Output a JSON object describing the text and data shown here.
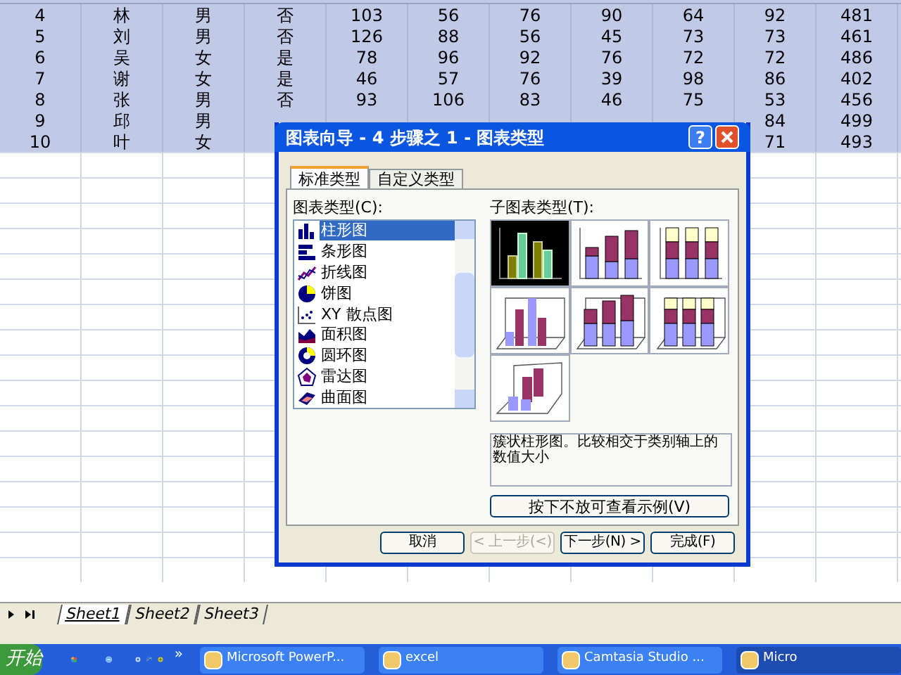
{
  "sheet": {
    "rows": [
      [
        "4",
        "林",
        "男",
        "否",
        "103",
        "56",
        "76",
        "90",
        "64",
        "92",
        "481"
      ],
      [
        "5",
        "刘",
        "男",
        "否",
        "126",
        "88",
        "56",
        "45",
        "73",
        "73",
        "461"
      ],
      [
        "6",
        "吴",
        "女",
        "是",
        "78",
        "96",
        "92",
        "76",
        "72",
        "72",
        "486"
      ],
      [
        "7",
        "谢",
        "女",
        "是",
        "46",
        "57",
        "76",
        "39",
        "98",
        "86",
        "402"
      ],
      [
        "8",
        "张",
        "男",
        "否",
        "93",
        "106",
        "83",
        "46",
        "75",
        "53",
        "456"
      ],
      [
        "9",
        "邱",
        "男",
        null,
        null,
        null,
        null,
        null,
        null,
        "84",
        "499"
      ],
      [
        "10",
        "叶",
        "女",
        null,
        null,
        null,
        null,
        null,
        null,
        "71",
        "493"
      ]
    ],
    "tabs": [
      {
        "label": "Sheet1",
        "selected": true
      },
      {
        "label": "Sheet2",
        "selected": false
      },
      {
        "label": "Sheet3",
        "selected": false
      }
    ]
  },
  "dialog": {
    "title": "图表向导 - 4 步骤之 1 - 图表类型",
    "help": "?",
    "tabs": [
      {
        "label": "标准类型",
        "selected": true
      },
      {
        "label": "自定义类型",
        "selected": false
      }
    ],
    "list_label": "图表类型(C):",
    "chart_types": [
      {
        "label": "柱形图",
        "selected": true
      },
      {
        "label": "条形图",
        "selected": false
      },
      {
        "label": "折线图",
        "selected": false
      },
      {
        "label": "饼图",
        "selected": false
      },
      {
        "label": "XY 散点图",
        "selected": false
      },
      {
        "label": "面积图",
        "selected": false
      },
      {
        "label": "圆环图",
        "selected": false
      },
      {
        "label": "雷达图",
        "selected": false
      },
      {
        "label": "曲面图",
        "selected": false
      }
    ],
    "subtype_label": "子图表类型(T):",
    "subtypes": [
      {
        "kind": "clustered",
        "selected": true
      },
      {
        "kind": "stacked",
        "selected": false
      },
      {
        "kind": "percent",
        "selected": false
      },
      {
        "kind": "clustered3d",
        "selected": false
      },
      {
        "kind": "stacked3d",
        "selected": false
      },
      {
        "kind": "percent3d",
        "selected": false
      },
      {
        "kind": "column3d",
        "selected": false
      }
    ],
    "description": "簇状柱形图。比较相交于类别轴上的数值大小",
    "preview_button": "按下不放可查看示例(V)",
    "buttons": [
      {
        "label": "取消",
        "disabled": false
      },
      {
        "label": "< 上一步(<)",
        "disabled": true
      },
      {
        "label": "下一步(N) >",
        "disabled": false
      },
      {
        "label": "完成(F)",
        "disabled": false
      }
    ]
  },
  "taskbar": {
    "start": "开始",
    "more": "»",
    "tasks": [
      {
        "label": "Microsoft PowerP...",
        "selected": false
      },
      {
        "label": "excel",
        "selected": false
      },
      {
        "label": "Camtasia Studio ...",
        "selected": false
      },
      {
        "label": "Micro",
        "selected": true
      }
    ]
  }
}
